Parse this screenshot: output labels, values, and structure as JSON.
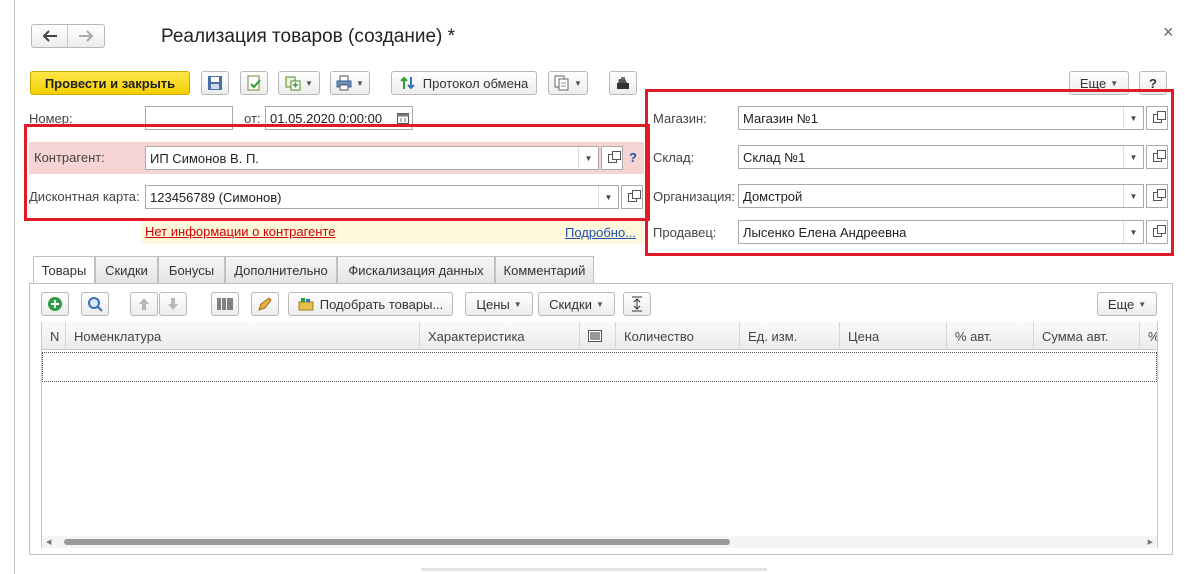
{
  "window": {
    "title": "Реализация товаров (создание) *",
    "close_glyph": "×"
  },
  "toolbar": {
    "post_and_close": "Провести и закрыть",
    "exchange_protocol": "Протокол обмена",
    "more": "Еще",
    "help": "?"
  },
  "header": {
    "number_label": "Номер:",
    "number_value": "",
    "date_label": "от:",
    "date_value": "01.05.2020  0:00:00",
    "counterparty_label": "Контрагент:",
    "counterparty_value": "ИП Симонов В. П.",
    "counterparty_help": "?",
    "discount_card_label": "Дисконтная карта:",
    "discount_card_value": "123456789 (Симонов)",
    "no_info_text": "Нет информации о контрагенте",
    "details_link": "Подробно..."
  },
  "right_panel": {
    "store_label": "Магазин:",
    "store_value": "Магазин №1",
    "warehouse_label": "Склад:",
    "warehouse_value": "Склад №1",
    "organization_label": "Организация:",
    "organization_value": "Домстрой",
    "seller_label": "Продавец:",
    "seller_value": "Лысенко Елена Андреевна"
  },
  "tabs": [
    {
      "label": "Товары"
    },
    {
      "label": "Скидки"
    },
    {
      "label": "Бонусы"
    },
    {
      "label": "Дополнительно"
    },
    {
      "label": "Фискализация данных"
    },
    {
      "label": "Комментарий"
    }
  ],
  "table_toolbar": {
    "pick_goods": "Подобрать товары...",
    "prices": "Цены",
    "discounts": "Скидки",
    "more": "Еще"
  },
  "table": {
    "columns": [
      "N",
      "Номенклатура",
      "Характеристика",
      "Количество",
      "Ед. изм.",
      "Цена",
      "% авт.",
      "Сумма авт.",
      "%"
    ],
    "rows": []
  },
  "colors": {
    "highlight_red": "#e01b24",
    "primary_yellow": "#f5cf00",
    "counterparty_bg": "#f7d4d4",
    "info_bar_bg": "#fdf8dc",
    "link_blue": "#1f4fb0"
  }
}
